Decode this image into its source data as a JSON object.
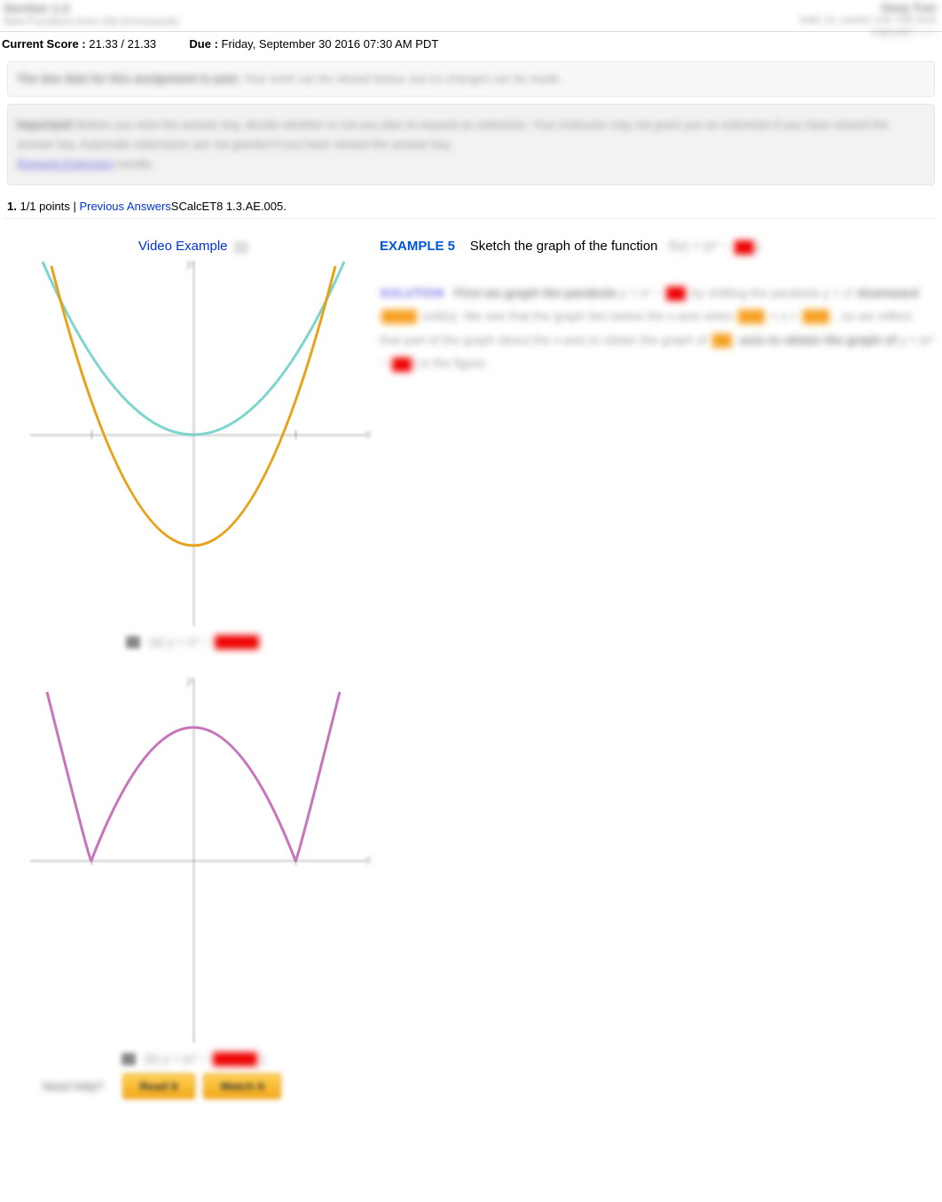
{
  "header": {
    "left": {
      "line1": "Section 1.3",
      "line2": "New Functions from Old (Homework)"
    },
    "right": {
      "line1": "Sang Tran",
      "line2": "Math 1A, section 109, Fall 2016",
      "line3": "Instructor: ——"
    }
  },
  "scorebar": {
    "score_label": "Current Score :",
    "score_value": "21.33 / 21.33",
    "due_label": "Due :",
    "due_value": "Friday, September 30 2016 07:30 AM PDT"
  },
  "notice": {
    "bold": "The due date for this assignment is past.",
    "rest": " Your work can be viewed below, but no changes can be made."
  },
  "important": {
    "lead": "Important!",
    "body": " Before you view the answer key, decide whether or not you plan to request an extension. Your Instructor may not grant you an extension if you have viewed the answer key. Automatic extensions are not granted if you have viewed the answer key.",
    "link": "Request Extension"
  },
  "question": {
    "num": "1.",
    "points": " 1/1 points  |  ",
    "prev": "Previous Answers",
    "source": "SCalcET8 1.3.AE.005",
    "dot": "."
  },
  "vid": {
    "text": "Video Example"
  },
  "example": {
    "label": "EXAMPLE 5",
    "prompt": "Sketch the graph of the function",
    "fn_lhs": "f(x) = |x² − ",
    "fn_blank": "1",
    "fn_rhs": "|."
  },
  "solution": {
    "label": "SOLUTION",
    "p1a": "First we graph the parabola ",
    "p1b": " by shifting the parabola ",
    "p2a": " downward ",
    "p2b": " unit(s). We see that the graph lies below the x-axis when ",
    "p2c": " < x < ",
    "p2d": ", so we reflect that part of the graph about the x-axis to obtain the graph of ",
    "p2e": " in the figure."
  },
  "chart_data": [
    {
      "type": "line",
      "title": "(a) y = x² − 1",
      "xlabel": "x",
      "ylabel": "y",
      "xlim": [
        -2,
        2
      ],
      "ylim": [
        -1.5,
        3
      ],
      "series": [
        {
          "name": "y = x² − 1",
          "color": "#e7a21a",
          "x": [
            -2,
            -1.5,
            -1,
            -0.5,
            0,
            0.5,
            1,
            1.5,
            2
          ],
          "values": [
            3,
            1.25,
            0,
            -0.75,
            -1,
            -0.75,
            0,
            1.25,
            3
          ]
        },
        {
          "name": "y = x²",
          "color": "#5ec9c0",
          "x": [
            -2,
            -1.5,
            -1,
            -0.5,
            0,
            0.5,
            1,
            1.5,
            2
          ],
          "values": [
            4,
            2.25,
            1,
            0.25,
            0,
            0.25,
            1,
            2.25,
            4
          ]
        }
      ],
      "x_ticks": [
        -1,
        1
      ]
    },
    {
      "type": "line",
      "title": "(b) y = |x² − 1|",
      "xlabel": "x",
      "ylabel": "y",
      "xlim": [
        -2,
        2
      ],
      "ylim": [
        -0.2,
        3
      ],
      "series": [
        {
          "name": "y = |x² − 1|",
          "color": "#c16fb7",
          "x": [
            -2,
            -1.5,
            -1,
            -0.5,
            0,
            0.5,
            1,
            1.5,
            2
          ],
          "values": [
            3,
            1.25,
            0,
            0.75,
            1,
            0.75,
            0,
            1.25,
            3
          ]
        }
      ],
      "x_ticks": [
        -1,
        1
      ]
    }
  ],
  "captions": {
    "a_lhs": "(a) y = x² − ",
    "a_box": "1",
    "b_lhs": "(b) y = |x² − ",
    "b_box": "1",
    "b_rhs": "|"
  },
  "buttons": {
    "need": "Need Help?",
    "read": "Read It",
    "watch": "Watch It"
  }
}
